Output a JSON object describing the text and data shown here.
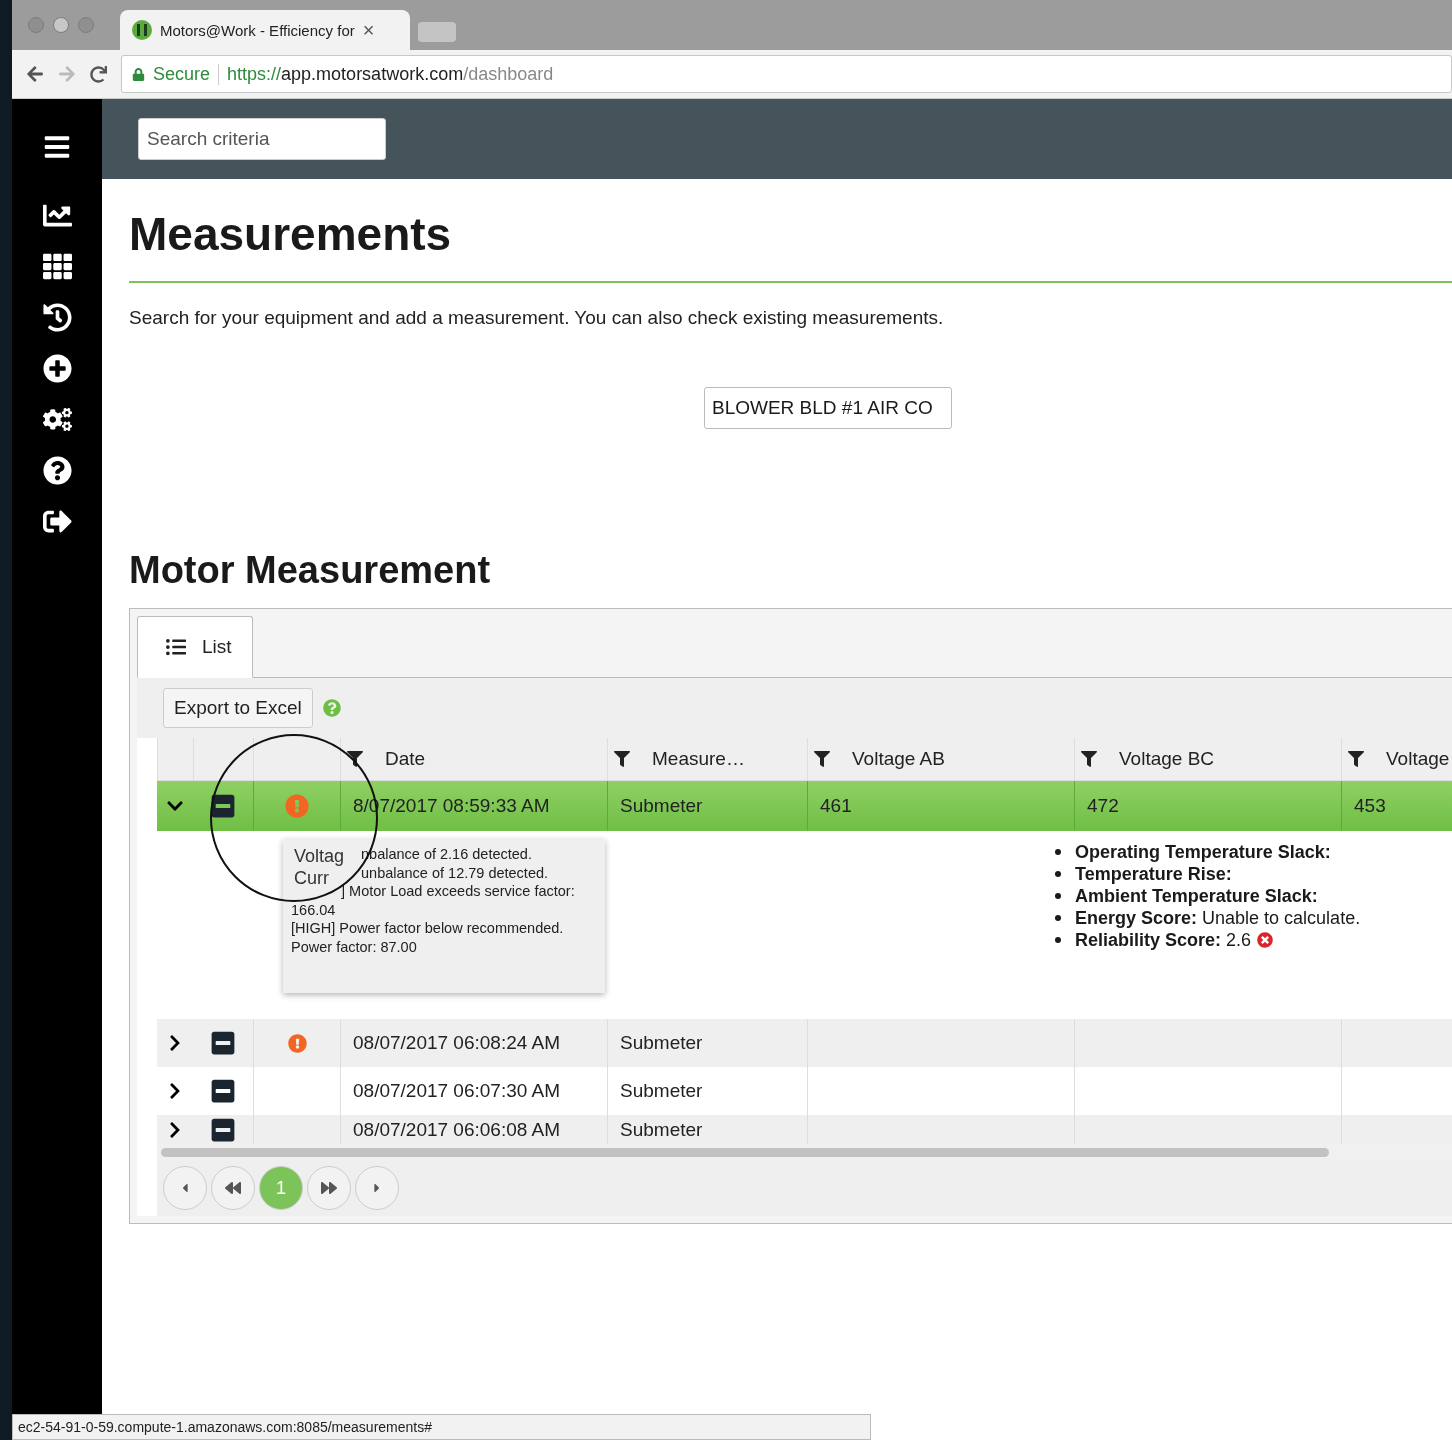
{
  "browser": {
    "tab_title": "Motors@Work - Efficiency for",
    "close": "×",
    "secure": "Secure",
    "url_scheme": "https://",
    "url_host": "app.motorsatwork.com",
    "url_path": "/dashboard"
  },
  "sidebar": {
    "items": [
      {
        "kind": "chart"
      },
      {
        "kind": "grid"
      },
      {
        "kind": "history"
      },
      {
        "kind": "add"
      },
      {
        "kind": "gears"
      },
      {
        "kind": "help"
      },
      {
        "kind": "logout"
      }
    ]
  },
  "search": {
    "placeholder": "Search criteria"
  },
  "page": {
    "title": "Measurements",
    "description": "Search for your equipment and add a measurement. You can also check existing measurements.",
    "equipment_button": "BLOWER BLD #1 AIR CO"
  },
  "section": {
    "title": "Motor Measurement"
  },
  "tabs": [
    {
      "label": "List",
      "selected": true
    }
  ],
  "toolbar": {
    "export": "Export to Excel"
  },
  "table": {
    "columns": [
      {
        "label": "Date",
        "filter": true
      },
      {
        "label": "Measure…",
        "filter": true
      },
      {
        "label": "Voltage AB",
        "filter": true
      },
      {
        "label": "Voltage BC",
        "filter": true
      },
      {
        "label": "Voltage",
        "filter": true
      }
    ],
    "rows": [
      {
        "expanded": true,
        "selected": true,
        "alert": true,
        "cells": [
          "8/07/2017 08:59:33 AM",
          "Submeter",
          "461",
          "472",
          "453"
        ]
      },
      {
        "expanded": false,
        "selected": false,
        "alert": true,
        "cells": [
          "08/07/2017 06:08:24 AM",
          "Submeter"
        ]
      },
      {
        "expanded": false,
        "selected": false,
        "alert": false,
        "cells": [
          "08/07/2017 06:07:30 AM",
          "Submeter"
        ]
      },
      {
        "expanded": false,
        "selected": false,
        "alert": false,
        "cells": [
          "08/07/2017 06:06:08 AM",
          "Submeter"
        ]
      }
    ],
    "details": [
      {
        "label": "Operating Temperature Slack:"
      },
      {
        "label": "Temperature Rise:"
      },
      {
        "label": "Ambient Temperature Slack:"
      },
      {
        "label": "Energy Score:",
        "value": "Unable to calculate."
      },
      {
        "label": "Reliability Score:",
        "value": "2.6",
        "error": true
      }
    ]
  },
  "tooltip": {
    "lines": [
      "nbalance of 2.16 detected.",
      "unbalance of 12.79 detected.",
      "] Motor Load exceeds service factor:",
      "166.04",
      "[HIGH] Power factor below recommended.",
      "Power factor:  87.00"
    ],
    "magnified": [
      "Voltag",
      "Curr"
    ]
  },
  "pager": {
    "pages": [
      {
        "label": "1",
        "selected": true
      }
    ]
  },
  "status_bar": {
    "text": "ec2-54-91-0-59.compute-1.amazonaws.com:8085/measurements#"
  }
}
